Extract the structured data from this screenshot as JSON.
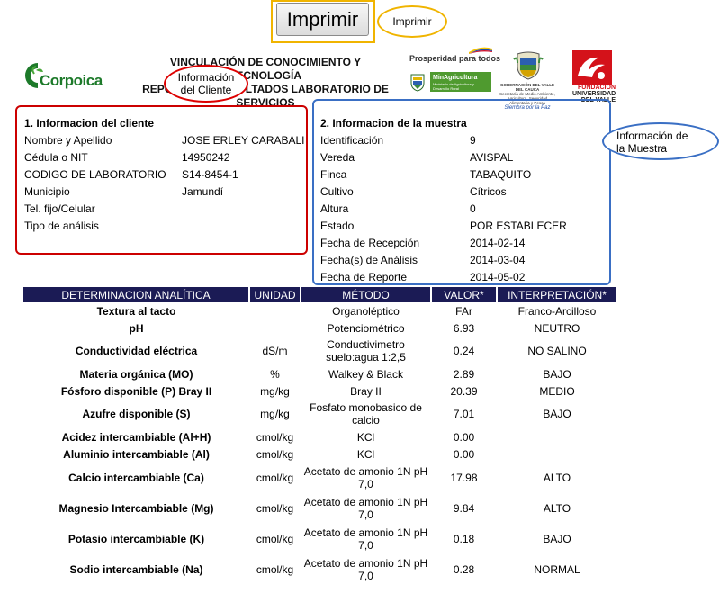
{
  "print_button": {
    "label": "Imprimir"
  },
  "callouts": {
    "print": "Imprimir",
    "cliente": [
      "Información",
      "del Cliente"
    ],
    "muestra": [
      "Información de",
      "la Muestra"
    ]
  },
  "header": {
    "title_lines": [
      "VINCULACIÓN DE CONOCIMIENTO Y TECNOLOGÍA",
      "REPORTE DE RESULTADOS LABORATORIO DE",
      "SERVICIOS"
    ],
    "logos": {
      "corpoica": "Corpoica",
      "prosperidad": "Prosperidad para todos",
      "minagricultura": "MinAgricultura",
      "minagricultura_sub": "Ministerio de Agricultura y Desarrollo Rural",
      "gobernacion": "GOBERNACIÓN DEL VALLE DEL CAUCA",
      "gobernacion_sub": "Secretaría de Medio Ambiente, Agricultura, Seguridad Alimentaria y Pesca",
      "gobernacion_motto": "Siembra por la Paz",
      "fundacion": "FUNDACIÓN",
      "universidad": "UNIVERSIDAD",
      "del_valle": "DEL VALLE"
    }
  },
  "cliente": {
    "title": "1. Informacion del cliente",
    "rows": [
      {
        "label": "Nombre y Apellido",
        "value": "JOSE ERLEY CARABALI"
      },
      {
        "label": "Cédula o NIT",
        "value": "14950242"
      },
      {
        "label": "CODIGO DE LABORATORIO",
        "value": "S14-8454-1"
      },
      {
        "label": "Municipio",
        "value": "Jamundí"
      },
      {
        "label": "Tel. fijo/Celular",
        "value": ""
      },
      {
        "label": "Tipo de análisis",
        "value": ""
      }
    ]
  },
  "muestra": {
    "title": "2. Informacion de la muestra",
    "rows": [
      {
        "label": "Identificación",
        "value": "9"
      },
      {
        "label": "Vereda",
        "value": "AVISPAL"
      },
      {
        "label": "Finca",
        "value": "TABAQUITO"
      },
      {
        "label": "Cultivo",
        "value": "Cítricos"
      },
      {
        "label": "Altura",
        "value": "0"
      },
      {
        "label": "Estado",
        "value": "POR ESTABLECER"
      },
      {
        "label": "Fecha de Recepción",
        "value": "2014-02-14"
      },
      {
        "label": "Fecha(s) de Análisis",
        "value": "2014-03-04"
      },
      {
        "label": "Fecha de Reporte",
        "value": "2014-05-02"
      }
    ]
  },
  "results": {
    "headers": [
      "DETERMINACION ANALÍTICA",
      "UNIDAD",
      "MÉTODO",
      "VALOR*",
      "INTERPRETACIÓN*"
    ],
    "rows": [
      {
        "param": "Textura al tacto",
        "unit": "",
        "method": "Organoléptico",
        "value": "FAr",
        "interp": "Franco-Arcilloso"
      },
      {
        "param": "pH",
        "unit": "",
        "method": "Potenciométrico",
        "value": "6.93",
        "interp": "NEUTRO"
      },
      {
        "param": "Conductividad eléctrica",
        "unit": "dS/m",
        "method": "Conductivimetro suelo:agua 1:2,5",
        "value": "0.24",
        "interp": "NO SALINO"
      },
      {
        "param": "Materia orgánica (MO)",
        "unit": "%",
        "method": "Walkey & Black",
        "value": "2.89",
        "interp": "BAJO"
      },
      {
        "param": "Fósforo disponible (P) Bray II",
        "unit": "mg/kg",
        "method": "Bray II",
        "value": "20.39",
        "interp": "MEDIO"
      },
      {
        "param": "Azufre disponible (S)",
        "unit": "mg/kg",
        "method": "Fosfato monobasico de calcio",
        "value": "7.01",
        "interp": "BAJO"
      },
      {
        "param": "Acidez intercambiable (Al+H)",
        "unit": "cmol/kg",
        "method": "KCl",
        "value": "0.00",
        "interp": ""
      },
      {
        "param": "Aluminio intercambiable (Al)",
        "unit": "cmol/kg",
        "method": "KCl",
        "value": "0.00",
        "interp": ""
      },
      {
        "param": "Calcio intercambiable (Ca)",
        "unit": "cmol/kg",
        "method": "Acetato de amonio 1N pH 7,0",
        "value": "17.98",
        "interp": "ALTO"
      },
      {
        "param": "Magnesio Intercambiable (Mg)",
        "unit": "cmol/kg",
        "method": "Acetato de amonio 1N pH 7,0",
        "value": "9.84",
        "interp": "ALTO"
      },
      {
        "param": "Potasio intercambiable (K)",
        "unit": "cmol/kg",
        "method": "Acetato de amonio 1N pH 7,0",
        "value": "0.18",
        "interp": "BAJO"
      },
      {
        "param": "Sodio intercambiable (Na)",
        "unit": "cmol/kg",
        "method": "Acetato de amonio 1N pH 7,0",
        "value": "0.28",
        "interp": "NORMAL"
      }
    ]
  },
  "colors": {
    "table_header_bg": "#1b1b55",
    "cliente_border": "#cc0000",
    "muestra_border": "#3a6fc4",
    "print_highlight": "#f0b400",
    "corpoica_green": "#1d7a2a"
  }
}
